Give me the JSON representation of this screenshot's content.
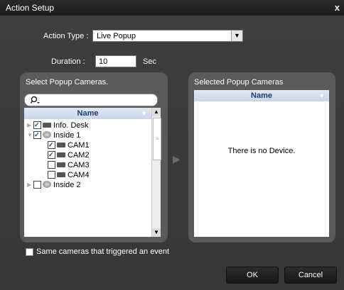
{
  "window": {
    "title": "Action Setup",
    "close_label": "x"
  },
  "action_type": {
    "label": "Action Type :",
    "value": "Live Popup"
  },
  "duration": {
    "label": "Duration :",
    "value": "10",
    "unit": "Sec"
  },
  "left_panel": {
    "title": "Select Popup Cameras.",
    "column": "Name",
    "rows": [
      {
        "label": "Info. Desk",
        "checked": true
      },
      {
        "label": "Inside 1",
        "checked": true
      },
      {
        "label": "CAM1",
        "checked": true
      },
      {
        "label": "CAM2",
        "checked": true
      },
      {
        "label": "CAM3",
        "checked": false
      },
      {
        "label": "CAM4",
        "checked": false
      },
      {
        "label": "Inside 2",
        "checked": false
      }
    ]
  },
  "right_panel": {
    "title": "Selected Popup Cameras",
    "column": "Name",
    "empty_text": "There is no Device."
  },
  "trigger_checkbox": {
    "label": "Same cameras that triggered an event",
    "checked": false
  },
  "buttons": {
    "ok": "OK",
    "cancel": "Cancel"
  }
}
